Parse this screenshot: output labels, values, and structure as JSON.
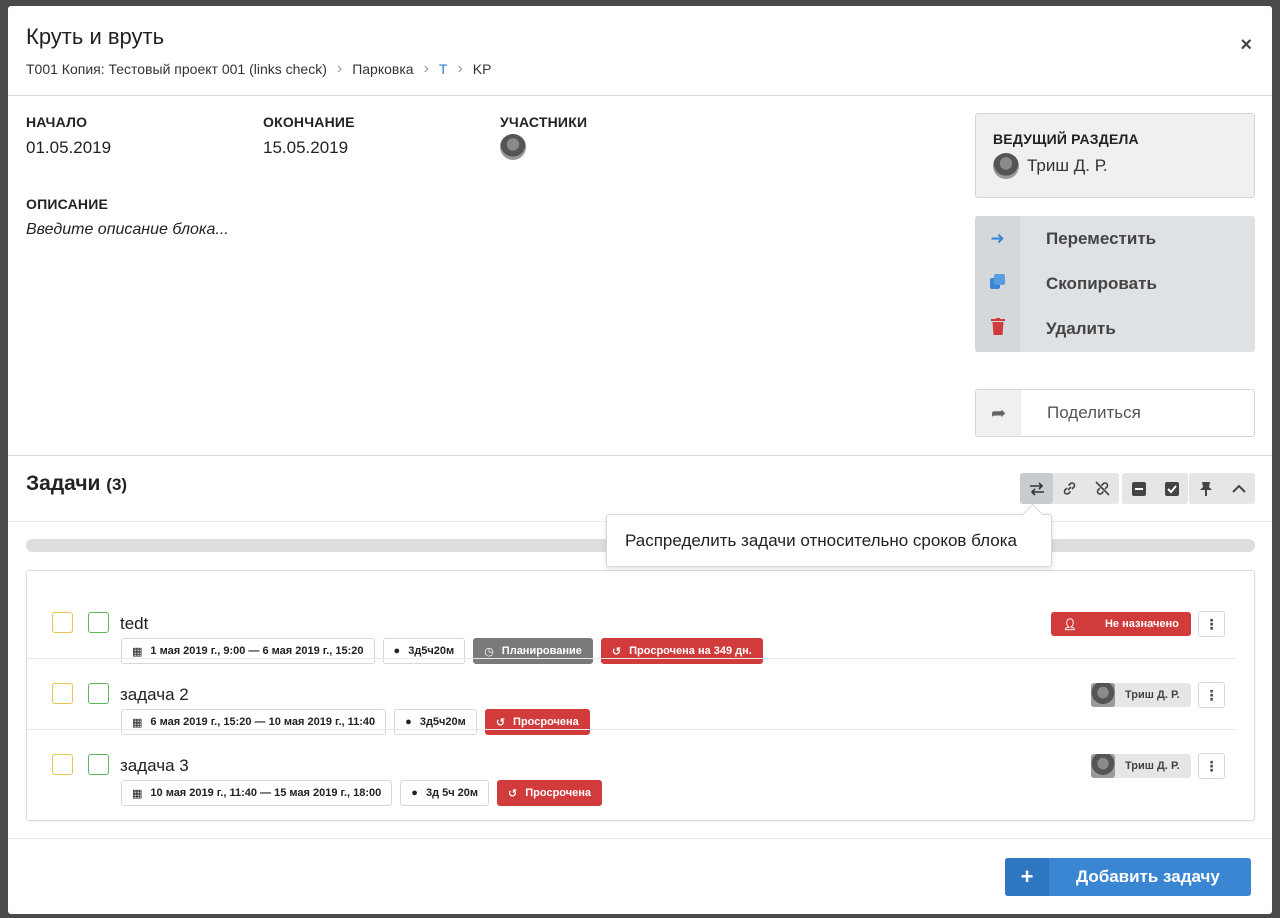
{
  "header": {
    "title": "Круть и вруть",
    "breadcrumbs": [
      "T001 Копия: Тестовый проект 001 (links check)",
      "Парковка",
      "T",
      "KP"
    ],
    "close_icon": "×"
  },
  "fields": {
    "start_label": "НАЧАЛО",
    "start_value": "01.05.2019",
    "end_label": "ОКОНЧАНИЕ",
    "end_value": "15.05.2019",
    "participants_label": "УЧАСТНИКИ",
    "description_label": "ОПИСАНИЕ",
    "description_placeholder": "Введите описание блока..."
  },
  "lead": {
    "label": "ВЕДУЩИЙ РАЗДЕЛА",
    "name": "Триш Д. Р."
  },
  "actions": [
    {
      "label": "Переместить",
      "icon": "arrow-right-icon",
      "color": "#3b86d3"
    },
    {
      "label": "Скопировать",
      "icon": "copy-icon",
      "color": "#3b86d3"
    },
    {
      "label": "Удалить",
      "icon": "trash-icon",
      "color": "#d23b3b"
    }
  ],
  "share": {
    "label": "Поделиться",
    "icon": "share-icon"
  },
  "tasks": {
    "title": "Задачи",
    "count": "(3)",
    "tooltip": "Распределить задачи относительно сроков блока",
    "add_label": "Добавить задачу",
    "items": [
      {
        "name": "tedt",
        "dates": "1 мая 2019 г., 9:00 — 6 мая 2019 г., 15:20",
        "duration": "3д5ч20м",
        "status": "Планирование",
        "overdue": "Просрочена на 349 дн.",
        "assignee": "Не назначено"
      },
      {
        "name": "задача 2",
        "dates": "6 мая 2019 г., 15:20 — 10 мая 2019 г., 11:40",
        "duration": "3д5ч20м",
        "overdue": "Просрочена",
        "assignee": "Триш Д. Р."
      },
      {
        "name": "задача 3",
        "dates": "10 мая 2019 г., 11:40 — 15 мая 2019 г., 18:00",
        "duration": "3д 5ч 20м",
        "overdue": "Просрочена",
        "assignee": "Триш Д. Р."
      }
    ]
  },
  "colors": {
    "accent": "#3b86d3",
    "danger": "#d23b3b",
    "status_gray": "#7a7a7a"
  }
}
